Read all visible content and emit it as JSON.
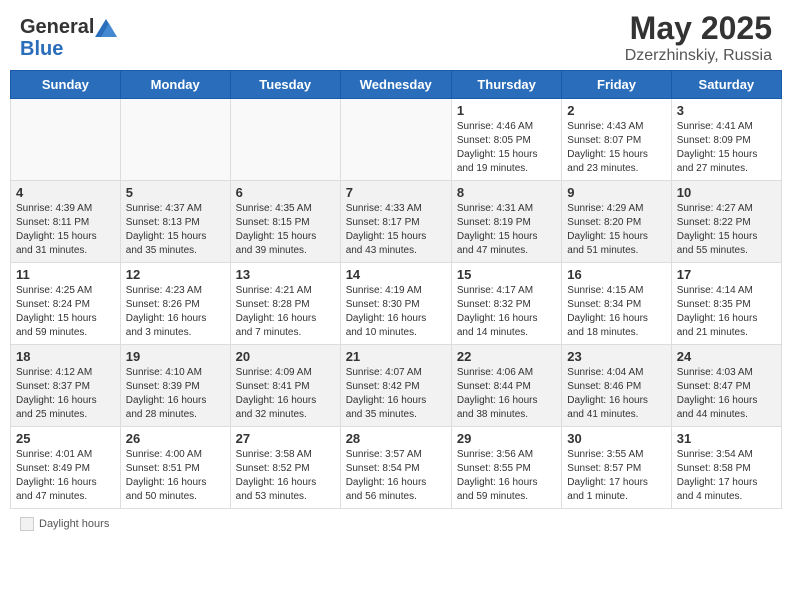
{
  "header": {
    "logo_general": "General",
    "logo_blue": "Blue",
    "main_title": "May 2025",
    "subtitle": "Dzerzhinskiy, Russia"
  },
  "days_of_week": [
    "Sunday",
    "Monday",
    "Tuesday",
    "Wednesday",
    "Thursday",
    "Friday",
    "Saturday"
  ],
  "weeks": [
    [
      {
        "day": "",
        "empty": true
      },
      {
        "day": "",
        "empty": true
      },
      {
        "day": "",
        "empty": true
      },
      {
        "day": "",
        "empty": true
      },
      {
        "day": "1",
        "info": "Sunrise: 4:46 AM\nSunset: 8:05 PM\nDaylight: 15 hours\nand 19 minutes."
      },
      {
        "day": "2",
        "info": "Sunrise: 4:43 AM\nSunset: 8:07 PM\nDaylight: 15 hours\nand 23 minutes."
      },
      {
        "day": "3",
        "info": "Sunrise: 4:41 AM\nSunset: 8:09 PM\nDaylight: 15 hours\nand 27 minutes."
      }
    ],
    [
      {
        "day": "4",
        "shaded": true,
        "info": "Sunrise: 4:39 AM\nSunset: 8:11 PM\nDaylight: 15 hours\nand 31 minutes."
      },
      {
        "day": "5",
        "shaded": true,
        "info": "Sunrise: 4:37 AM\nSunset: 8:13 PM\nDaylight: 15 hours\nand 35 minutes."
      },
      {
        "day": "6",
        "shaded": true,
        "info": "Sunrise: 4:35 AM\nSunset: 8:15 PM\nDaylight: 15 hours\nand 39 minutes."
      },
      {
        "day": "7",
        "shaded": true,
        "info": "Sunrise: 4:33 AM\nSunset: 8:17 PM\nDaylight: 15 hours\nand 43 minutes."
      },
      {
        "day": "8",
        "shaded": true,
        "info": "Sunrise: 4:31 AM\nSunset: 8:19 PM\nDaylight: 15 hours\nand 47 minutes."
      },
      {
        "day": "9",
        "shaded": true,
        "info": "Sunrise: 4:29 AM\nSunset: 8:20 PM\nDaylight: 15 hours\nand 51 minutes."
      },
      {
        "day": "10",
        "shaded": true,
        "info": "Sunrise: 4:27 AM\nSunset: 8:22 PM\nDaylight: 15 hours\nand 55 minutes."
      }
    ],
    [
      {
        "day": "11",
        "info": "Sunrise: 4:25 AM\nSunset: 8:24 PM\nDaylight: 15 hours\nand 59 minutes."
      },
      {
        "day": "12",
        "info": "Sunrise: 4:23 AM\nSunset: 8:26 PM\nDaylight: 16 hours\nand 3 minutes."
      },
      {
        "day": "13",
        "info": "Sunrise: 4:21 AM\nSunset: 8:28 PM\nDaylight: 16 hours\nand 7 minutes."
      },
      {
        "day": "14",
        "info": "Sunrise: 4:19 AM\nSunset: 8:30 PM\nDaylight: 16 hours\nand 10 minutes."
      },
      {
        "day": "15",
        "info": "Sunrise: 4:17 AM\nSunset: 8:32 PM\nDaylight: 16 hours\nand 14 minutes."
      },
      {
        "day": "16",
        "info": "Sunrise: 4:15 AM\nSunset: 8:34 PM\nDaylight: 16 hours\nand 18 minutes."
      },
      {
        "day": "17",
        "info": "Sunrise: 4:14 AM\nSunset: 8:35 PM\nDaylight: 16 hours\nand 21 minutes."
      }
    ],
    [
      {
        "day": "18",
        "shaded": true,
        "info": "Sunrise: 4:12 AM\nSunset: 8:37 PM\nDaylight: 16 hours\nand 25 minutes."
      },
      {
        "day": "19",
        "shaded": true,
        "info": "Sunrise: 4:10 AM\nSunset: 8:39 PM\nDaylight: 16 hours\nand 28 minutes."
      },
      {
        "day": "20",
        "shaded": true,
        "info": "Sunrise: 4:09 AM\nSunset: 8:41 PM\nDaylight: 16 hours\nand 32 minutes."
      },
      {
        "day": "21",
        "shaded": true,
        "info": "Sunrise: 4:07 AM\nSunset: 8:42 PM\nDaylight: 16 hours\nand 35 minutes."
      },
      {
        "day": "22",
        "shaded": true,
        "info": "Sunrise: 4:06 AM\nSunset: 8:44 PM\nDaylight: 16 hours\nand 38 minutes."
      },
      {
        "day": "23",
        "shaded": true,
        "info": "Sunrise: 4:04 AM\nSunset: 8:46 PM\nDaylight: 16 hours\nand 41 minutes."
      },
      {
        "day": "24",
        "shaded": true,
        "info": "Sunrise: 4:03 AM\nSunset: 8:47 PM\nDaylight: 16 hours\nand 44 minutes."
      }
    ],
    [
      {
        "day": "25",
        "info": "Sunrise: 4:01 AM\nSunset: 8:49 PM\nDaylight: 16 hours\nand 47 minutes."
      },
      {
        "day": "26",
        "info": "Sunrise: 4:00 AM\nSunset: 8:51 PM\nDaylight: 16 hours\nand 50 minutes."
      },
      {
        "day": "27",
        "info": "Sunrise: 3:58 AM\nSunset: 8:52 PM\nDaylight: 16 hours\nand 53 minutes."
      },
      {
        "day": "28",
        "info": "Sunrise: 3:57 AM\nSunset: 8:54 PM\nDaylight: 16 hours\nand 56 minutes."
      },
      {
        "day": "29",
        "info": "Sunrise: 3:56 AM\nSunset: 8:55 PM\nDaylight: 16 hours\nand 59 minutes."
      },
      {
        "day": "30",
        "info": "Sunrise: 3:55 AM\nSunset: 8:57 PM\nDaylight: 17 hours\nand 1 minute."
      },
      {
        "day": "31",
        "info": "Sunrise: 3:54 AM\nSunset: 8:58 PM\nDaylight: 17 hours\nand 4 minutes."
      }
    ]
  ],
  "footer": {
    "daylight_hours_label": "Daylight hours"
  }
}
